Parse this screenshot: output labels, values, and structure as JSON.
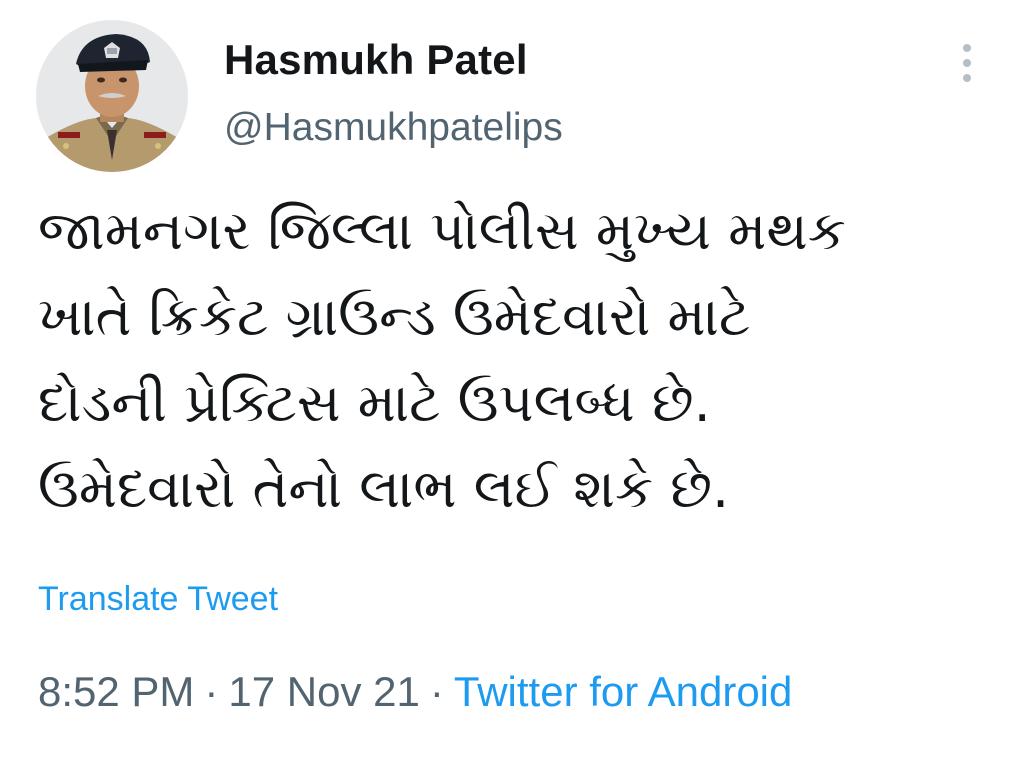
{
  "author": {
    "display_name": "Hasmukh Patel",
    "handle": "@Hasmukhpatelips",
    "avatar_icon": "police-officer-avatar"
  },
  "tweet": {
    "lines": [
      "જામનગર જિલ્લા પોલીસ મુખ્ય મથક",
      "ખાતે ક્રિકેટ ગ્રાઉન્ડ ઉમેદવારો માટે",
      "દોડની પ્રેક્ટિસ માટે ઉપલબ્ધ છે.",
      "ઉમેદવારો તેનો લાભ લઈ શકે છે."
    ],
    "translate_label": "Translate Tweet"
  },
  "meta": {
    "time": "8:52 PM",
    "separator": "·",
    "date": "17 Nov 21",
    "source": "Twitter for Android"
  },
  "colors": {
    "link": "#1d9bf0",
    "secondary_text": "#536471",
    "primary_text": "#14171a"
  }
}
